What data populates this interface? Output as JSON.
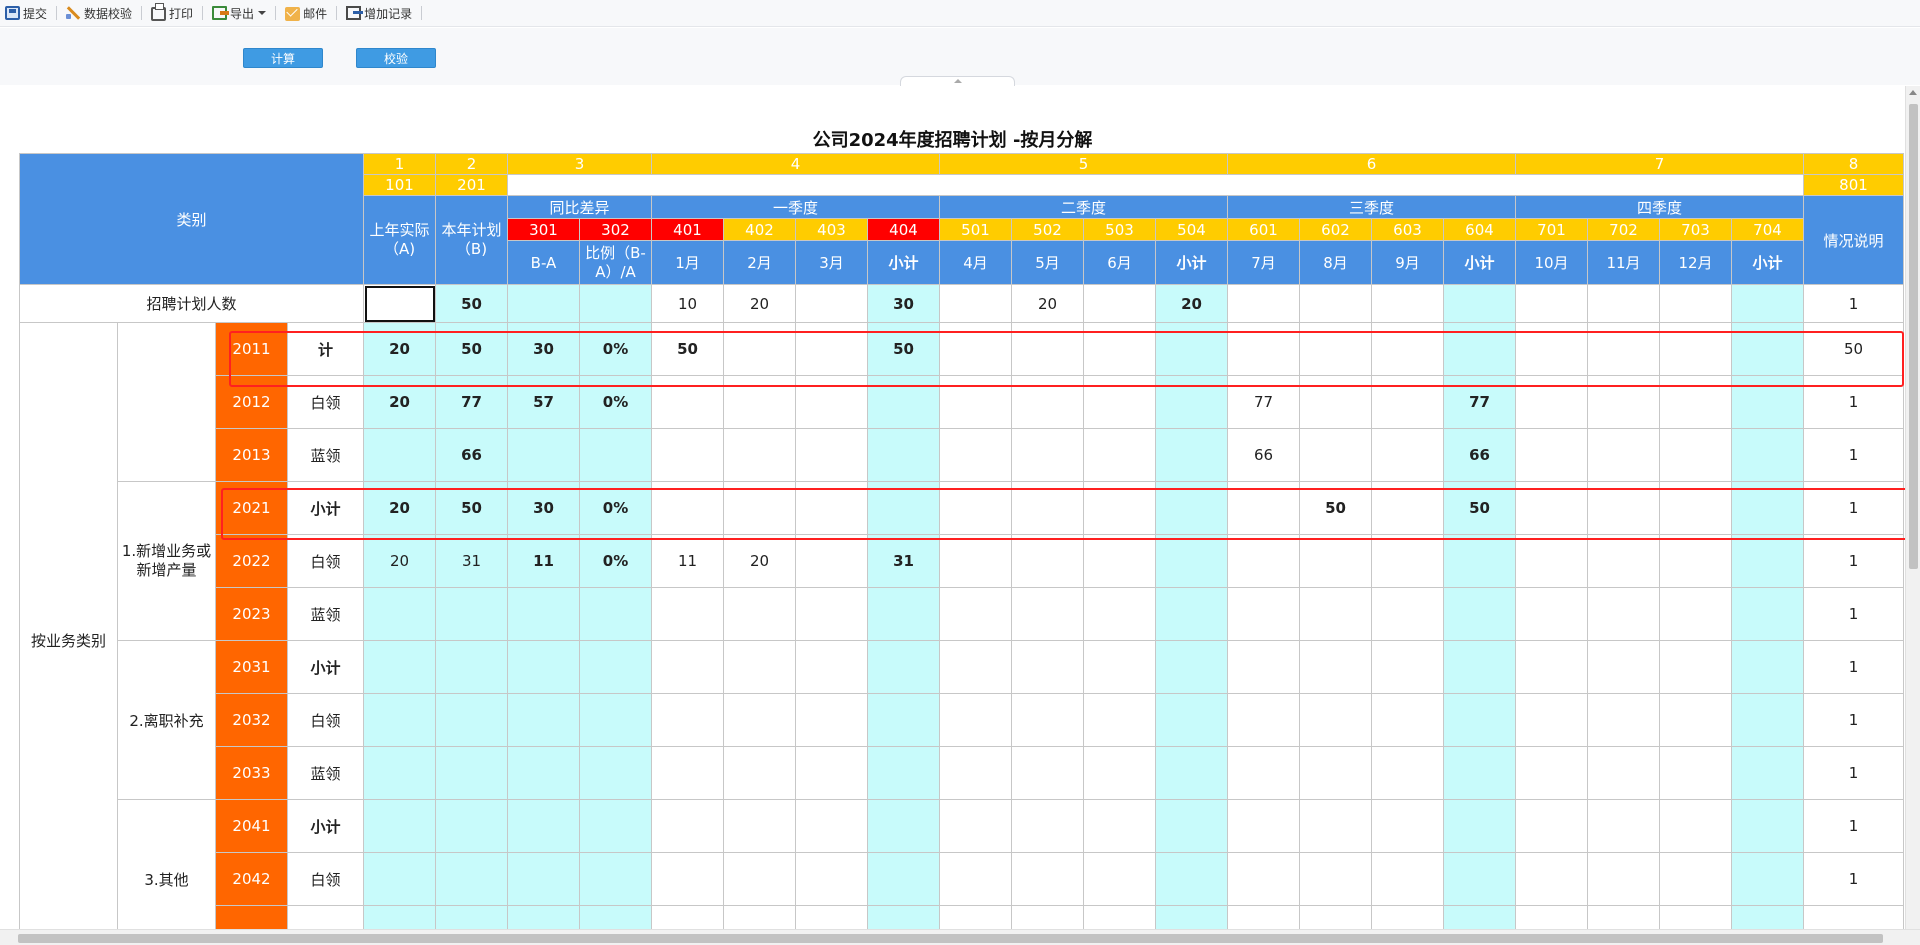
{
  "toolbar": {
    "submit": "提交",
    "data_check": "数据校验",
    "print": "打印",
    "export": "导出",
    "mail": "邮件",
    "add_record": "增加记录"
  },
  "actions": {
    "calculate": "计算",
    "verify": "校验"
  },
  "report": {
    "title": "公司2024年度招聘计划 -按月分解",
    "header": {
      "category": "类别",
      "col_index": [
        "1",
        "2",
        "3",
        "4",
        "5",
        "6",
        "7",
        "8"
      ],
      "code_101": "101",
      "code_201": "201",
      "code_801": "801",
      "last_year_actual": "上年实际（A)",
      "this_year_plan": "本年计划（B)",
      "yoy_diff": "同比差异",
      "q1": "一季度",
      "q2": "二季度",
      "q3": "三季度",
      "q4": "四季度",
      "note": "情况说明",
      "sub_codes": [
        "301",
        "302",
        "401",
        "402",
        "403",
        "404",
        "501",
        "502",
        "503",
        "504",
        "601",
        "602",
        "603",
        "604",
        "701",
        "702",
        "703",
        "704"
      ],
      "sub_labels": [
        "B-A",
        "比例（B-A）/A",
        "1月",
        "2月",
        "3月",
        "小计",
        "4月",
        "5月",
        "6月",
        "小计",
        "7月",
        "8月",
        "9月",
        "小计",
        "10月",
        "11月",
        "12月",
        "小计"
      ]
    },
    "top_row": {
      "label": "招聘计划人数",
      "values": [
        "",
        "50",
        "",
        "",
        "10",
        "20",
        "",
        "30",
        "",
        "20",
        "",
        "20",
        "",
        "",
        "",
        "",
        "",
        "",
        "",
        "",
        "1"
      ]
    },
    "groups": {
      "by_business": "按业务类别",
      "new_business": "1.新增业务或新增产量",
      "turnover": "2.离职补充",
      "other": "3.其他"
    },
    "rows": [
      {
        "code": "2011",
        "name": "计",
        "values": [
          "20",
          "50",
          "30",
          "0%",
          "50",
          "",
          "",
          "50",
          "",
          "",
          "",
          "",
          "",
          "",
          "",
          "",
          "",
          "",
          "",
          "",
          "50"
        ]
      },
      {
        "code": "2012",
        "name": "白领",
        "values": [
          "20",
          "77",
          "57",
          "0%",
          "",
          "",
          "",
          "",
          "",
          "",
          "",
          "",
          "77",
          "",
          "",
          "77",
          "",
          "",
          "",
          "",
          "1"
        ]
      },
      {
        "code": "2013",
        "name": "蓝领",
        "values": [
          "",
          "66",
          "",
          "",
          "",
          "",
          "",
          "",
          "",
          "",
          "",
          "",
          "66",
          "",
          "",
          "66",
          "",
          "",
          "",
          "",
          "1"
        ]
      },
      {
        "code": "2021",
        "name": "小计",
        "values": [
          "20",
          "50",
          "30",
          "0%",
          "",
          "",
          "",
          "",
          "",
          "",
          "",
          "",
          "",
          "50",
          "",
          "50",
          "",
          "",
          "",
          "",
          "1"
        ]
      },
      {
        "code": "2022",
        "name": "白领",
        "values": [
          "20",
          "31",
          "11",
          "0%",
          "11",
          "20",
          "",
          "31",
          "",
          "",
          "",
          "",
          "",
          "",
          "",
          "",
          "",
          "",
          "",
          "",
          "1"
        ]
      },
      {
        "code": "2023",
        "name": "蓝领",
        "values": [
          "",
          "",
          "",
          "",
          "",
          "",
          "",
          "",
          "",
          "",
          "",
          "",
          "",
          "",
          "",
          "",
          "",
          "",
          "",
          "",
          "1"
        ]
      },
      {
        "code": "2031",
        "name": "小计",
        "values": [
          "",
          "",
          "",
          "",
          "",
          "",
          "",
          "",
          "",
          "",
          "",
          "",
          "",
          "",
          "",
          "",
          "",
          "",
          "",
          "",
          "1"
        ]
      },
      {
        "code": "2032",
        "name": "白领",
        "values": [
          "",
          "",
          "",
          "",
          "",
          "",
          "",
          "",
          "",
          "",
          "",
          "",
          "",
          "",
          "",
          "",
          "",
          "",
          "",
          "",
          "1"
        ]
      },
      {
        "code": "2033",
        "name": "蓝领",
        "values": [
          "",
          "",
          "",
          "",
          "",
          "",
          "",
          "",
          "",
          "",
          "",
          "",
          "",
          "",
          "",
          "",
          "",
          "",
          "",
          "",
          "1"
        ]
      },
      {
        "code": "2041",
        "name": "小计",
        "values": [
          "",
          "",
          "",
          "",
          "",
          "",
          "",
          "",
          "",
          "",
          "",
          "",
          "",
          "",
          "",
          "",
          "",
          "",
          "",
          "",
          "1"
        ]
      },
      {
        "code": "2042",
        "name": "白领",
        "values": [
          "",
          "",
          "",
          "",
          "",
          "",
          "",
          "",
          "",
          "",
          "",
          "",
          "",
          "",
          "",
          "",
          "",
          "",
          "",
          "",
          "1"
        ]
      },
      {
        "code": "",
        "name": "",
        "values": [
          "",
          "",
          "",
          "",
          "",
          "",
          "",
          "",
          "",
          "",
          "",
          "",
          "",
          "",
          "",
          "",
          "",
          "",
          "",
          "",
          ""
        ]
      }
    ]
  }
}
